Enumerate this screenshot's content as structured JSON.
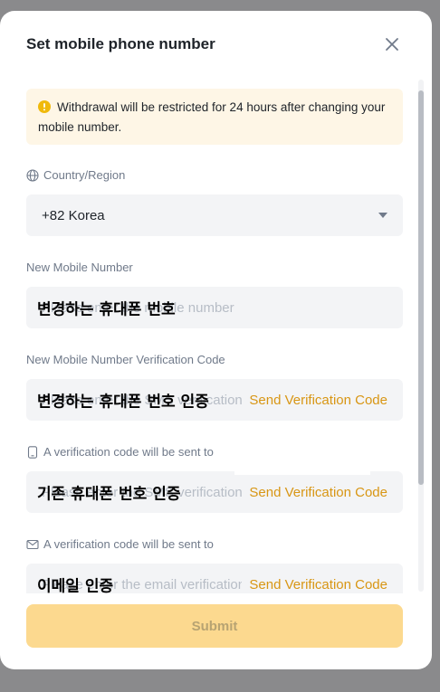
{
  "modal": {
    "title": "Set mobile phone number",
    "notice": "Withdrawal will be restricted for 24 hours after changing your mobile number."
  },
  "country": {
    "label": "Country/Region",
    "value": "+82 Korea"
  },
  "new_mobile": {
    "label": "New Mobile Number",
    "placeholder": "Please enter the mobile number",
    "overlay": "변경하는 휴대폰 번호"
  },
  "new_mobile_code": {
    "label": "New Mobile Number Verification Code",
    "placeholder": "Please enter the SMS verification code",
    "send_label": "Send Verification Code",
    "overlay": "변경하는 휴대폰 번호 인증"
  },
  "old_mobile_code": {
    "label": "A verification code will be sent to",
    "placeholder": "Please enter the SMS verification code",
    "send_label": "Send Verification Code",
    "overlay": "기존 휴대폰 번호 인증"
  },
  "email_code": {
    "label": "A verification code will be sent to",
    "placeholder": "Please enter the email verification code",
    "send_label": "Send Verification Code",
    "overlay": "이메일 인증"
  },
  "submit_label": "Submit",
  "colors": {
    "accent": "#d89614",
    "submit_disabled": "#fcd98f",
    "notice_bg": "#fef6e6",
    "input_bg": "#f3f4f6"
  }
}
